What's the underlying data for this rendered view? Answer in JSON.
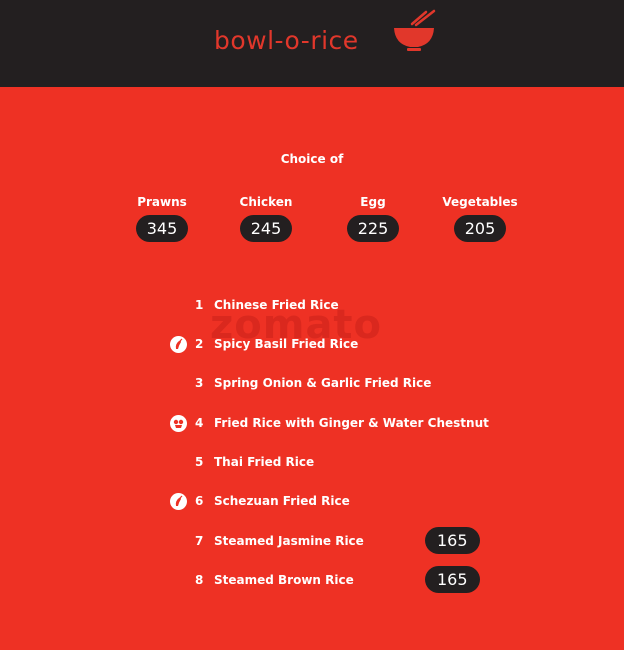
{
  "header": {
    "brand": "bowl-o-rice",
    "logo_icon": "rice-bowl-with-chopsticks-icon",
    "bg_color": "#231f20",
    "accent_color": "#e1372b"
  },
  "menu": {
    "bg_color": "#ee3124",
    "choice_title": "Choice of",
    "proteins": [
      {
        "name": "Prawns",
        "price": "345"
      },
      {
        "name": "Chicken",
        "price": "245"
      },
      {
        "name": "Egg",
        "price": "225"
      },
      {
        "name": "Vegetables",
        "price": "205"
      }
    ],
    "items": [
      {
        "num": "1",
        "label": "Chinese Fried Rice",
        "icon": ""
      },
      {
        "num": "2",
        "label": "Spicy Basil Fried Rice",
        "icon": "chili-pepper-icon"
      },
      {
        "num": "3",
        "label": "Spring Onion & Garlic Fried Rice",
        "icon": ""
      },
      {
        "num": "4",
        "label": "Fried Rice with Ginger & Water Chestnut",
        "icon": "chef-recommended-icon"
      },
      {
        "num": "5",
        "label": "Thai Fried Rice",
        "icon": ""
      },
      {
        "num": "6",
        "label": "Schezuan Fried Rice",
        "icon": "chili-pepper-icon"
      },
      {
        "num": "7",
        "label": "Steamed Jasmine Rice",
        "icon": "",
        "price": "165"
      },
      {
        "num": "8",
        "label": "Steamed Brown Rice",
        "icon": "",
        "price": "165"
      }
    ],
    "watermark": "zomato"
  }
}
